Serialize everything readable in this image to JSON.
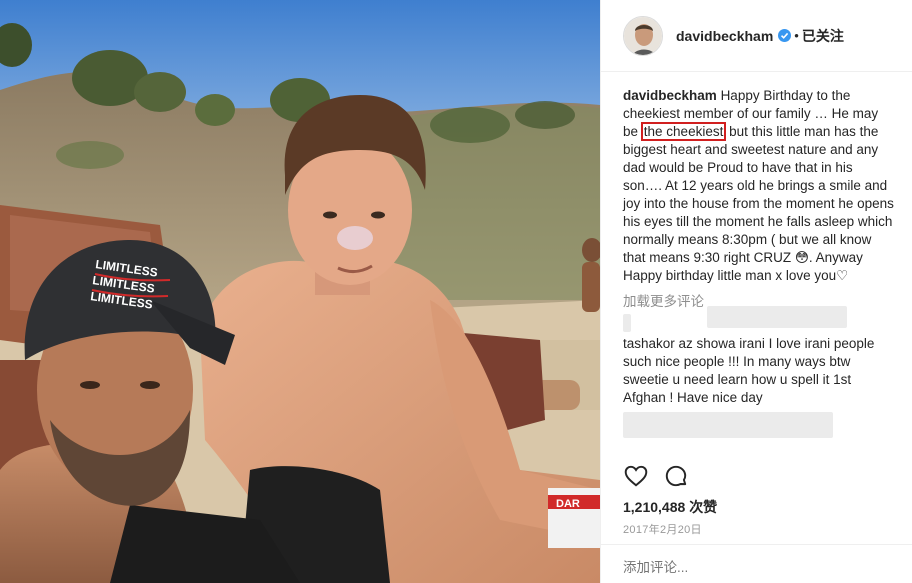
{
  "post": {
    "username": "davidbeckham",
    "separator": "•",
    "follow_label": "已关注",
    "caption": {
      "before_highlight": "Happy Birthday to the cheekiest member of our family … He may be ",
      "highlight": "the cheekiest",
      "after_highlight": " but this little man has the biggest heart and sweetest nature and any dad would be Proud to have that in his son…. At 12 years old he brings a smile and joy into the house from the moment he opens his eyes till the moment he falls asleep which normally means 8:30pm ( but we all know that means 9:30 right CRUZ ",
      "emoji": "😳",
      "end": ". Anyway Happy birthday little man x love you♡"
    },
    "load_more_label": "加载更多评论",
    "comment": {
      "text": "tashakor az showa irani I love irani people such nice people !!! In many ways btw sweetie u need learn how u spell it 1st Afghan ! Have nice day"
    },
    "likes": "1,210,488",
    "likes_suffix": "次赞",
    "date": "2017年2月20日",
    "add_comment_placeholder": "添加评论..."
  },
  "photo": {
    "cap_text": [
      "LIMITLESS",
      "LIMITLESS",
      "LIMITLESS"
    ],
    "bag_text": "DAR"
  },
  "icons": {
    "verified": "verified-badge-icon",
    "like": "heart-icon",
    "comment": "comment-bubble-icon"
  },
  "colors": {
    "highlight_box": "#d11f1f",
    "verified_blue": "#3897f0",
    "muted_text": "#999999"
  }
}
